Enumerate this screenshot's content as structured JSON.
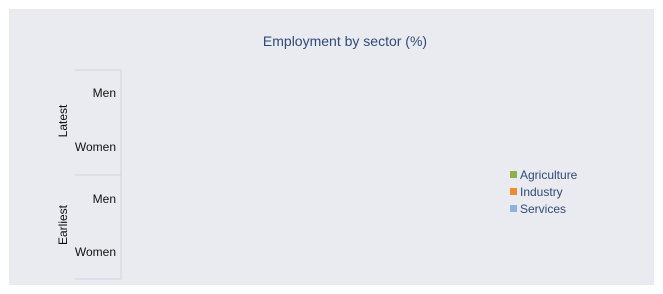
{
  "chart_data": {
    "type": "bar",
    "orientation": "horizontal",
    "stacked": true,
    "title": "Employment by sector (%)",
    "groups": [
      {
        "label": "Latest",
        "categories": [
          "Men",
          "Women"
        ]
      },
      {
        "label": "Earliest",
        "categories": [
          "Men",
          "Women"
        ]
      }
    ],
    "categories": [
      "Latest – Men",
      "Latest – Women",
      "Earliest – Men",
      "Earliest – Women"
    ],
    "series": [
      {
        "name": "Agriculture",
        "color": "#8db14a",
        "values": [
          null,
          null,
          null,
          null
        ]
      },
      {
        "name": "Industry",
        "color": "#f08a30",
        "values": [
          null,
          null,
          null,
          null
        ]
      },
      {
        "name": "Services",
        "color": "#8fb0e0",
        "values": [
          null,
          null,
          null,
          null
        ]
      }
    ],
    "legend_position": "right",
    "grid": false
  }
}
